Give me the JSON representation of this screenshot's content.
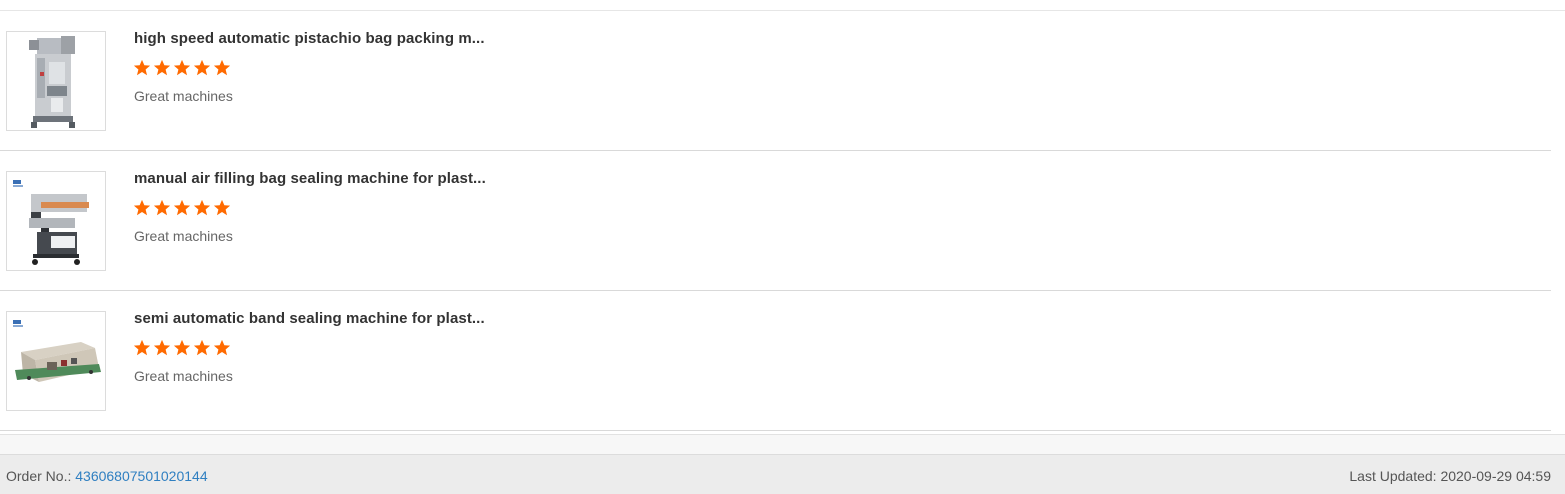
{
  "reviews": [
    {
      "title": "high speed automatic pistachio bag packing m...",
      "rating": 5,
      "rating_max": 5,
      "comment": "Great machines",
      "image_icon": "vertical-packing-machine-image"
    },
    {
      "title": "manual air filling bag sealing machine for plast...",
      "rating": 5,
      "rating_max": 5,
      "comment": "Great machines",
      "image_icon": "vertical-band-sealer-image"
    },
    {
      "title": "semi automatic band sealing machine for plast...",
      "rating": 5,
      "rating_max": 5,
      "comment": "Great machines",
      "image_icon": "horizontal-band-sealer-image"
    }
  ],
  "footer": {
    "order_label": "Order No.:",
    "order_number": "43606807501020144",
    "last_updated_label": "Last Updated:",
    "last_updated_value": "2020-09-29 04:59"
  },
  "colors": {
    "star": "#ff6a00",
    "link": "#2f7fc1",
    "footer_bg": "#ececec"
  }
}
